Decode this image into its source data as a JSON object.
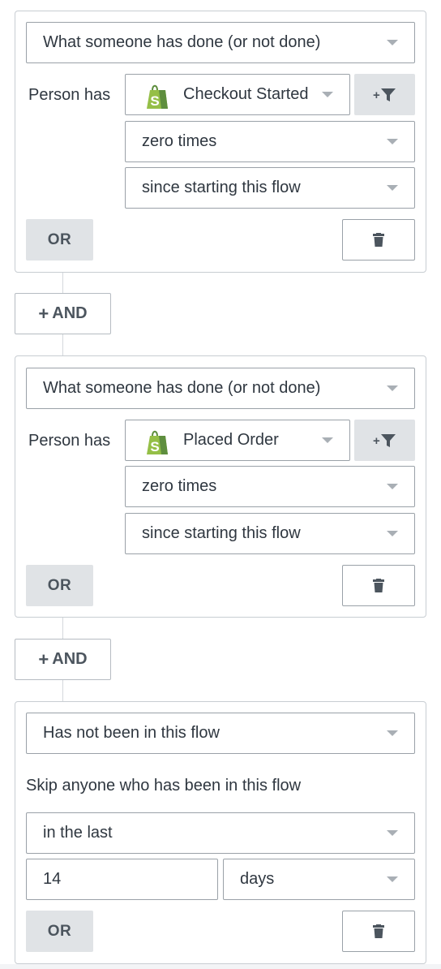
{
  "conditions": [
    {
      "type_select": "What someone has done (or not done)",
      "person_has_label": "Person has",
      "metric": "Checkout Started",
      "metric_icon": "shopify-bag-icon",
      "frequency": "zero times",
      "timeframe": "since starting this flow",
      "or_label": "OR"
    },
    {
      "type_select": "What someone has done (or not done)",
      "person_has_label": "Person has",
      "metric": "Placed Order",
      "metric_icon": "shopify-bag-icon",
      "frequency": "zero times",
      "timeframe": "since starting this flow",
      "or_label": "OR"
    },
    {
      "type_select": "Has not been in this flow",
      "description": "Skip anyone who has been in this flow",
      "range": "in the last",
      "amount": "14",
      "unit": "days",
      "or_label": "OR"
    }
  ],
  "and_label": "AND",
  "filter_button_label": "+",
  "colors": {
    "shopify_green": "#95bf47",
    "shopify_dark_green": "#5e8e3e",
    "button_gray": "#e0e3e6",
    "border": "#9aa1a8"
  }
}
